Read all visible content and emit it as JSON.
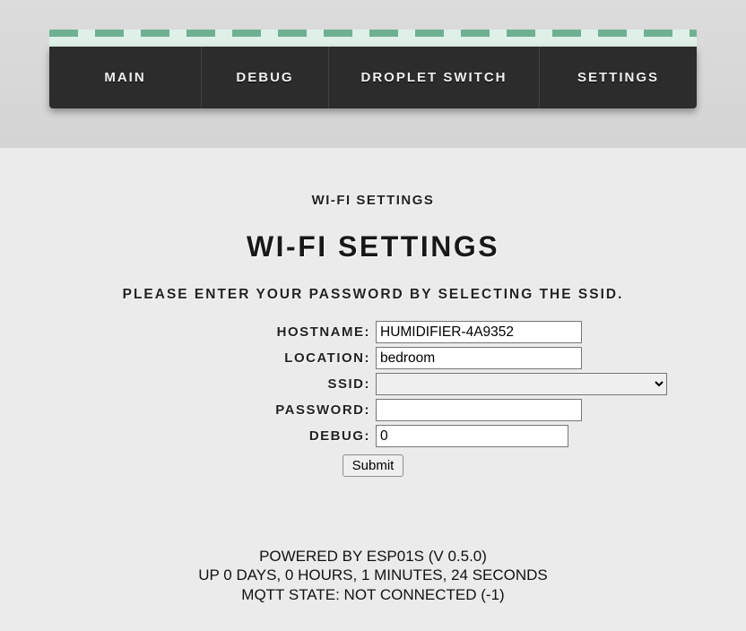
{
  "nav": {
    "items": [
      {
        "label": "MAIN"
      },
      {
        "label": "DEBUG"
      },
      {
        "label": "DROPLET SWITCH"
      },
      {
        "label": "SETTINGS"
      }
    ]
  },
  "page": {
    "breadcrumb": "WI-FI SETTINGS",
    "title": "WI-FI SETTINGS",
    "subtitle": "PLEASE ENTER YOUR PASSWORD BY SELECTING THE SSID."
  },
  "form": {
    "hostname": {
      "label": "HOSTNAME:",
      "value": "HUMIDIFIER-4A9352"
    },
    "location": {
      "label": "LOCATION:",
      "value": "bedroom"
    },
    "ssid": {
      "label": "SSID:",
      "selected": ""
    },
    "password": {
      "label": "PASSWORD:",
      "value": ""
    },
    "debug": {
      "label": "DEBUG:",
      "value": "0"
    },
    "submit_label": "Submit"
  },
  "footer": {
    "powered": "POWERED BY ESP01S (V 0.5.0)",
    "uptime": "UP 0 DAYS, 0 HOURS, 1 MINUTES, 24 SECONDS",
    "mqtt": "MQTT STATE: NOT CONNECTED (-1)"
  }
}
